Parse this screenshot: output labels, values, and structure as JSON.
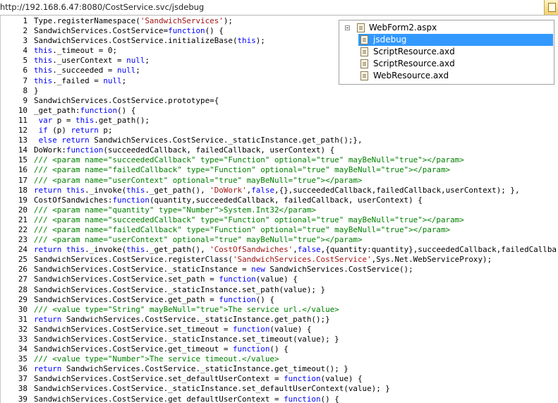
{
  "address_bar": {
    "url": "http://192.168.6.47:8080/CostService.svc/jsdebug"
  },
  "code_lines": [
    {
      "n": "1",
      "t": [
        [
          "p",
          "Type.registerNamespace("
        ],
        [
          "s",
          "'SandwichServices'"
        ],
        [
          "p",
          ");"
        ]
      ]
    },
    {
      "n": "2",
      "t": [
        [
          "p",
          "SandwichServices.CostService="
        ],
        [
          "k",
          "function"
        ],
        [
          "p",
          "() {"
        ]
      ]
    },
    {
      "n": "3",
      "t": [
        [
          "p",
          "SandwichServices.CostService.initializeBase("
        ],
        [
          "k",
          "this"
        ],
        [
          "p",
          ");"
        ]
      ]
    },
    {
      "n": "4",
      "t": [
        [
          "k",
          "this"
        ],
        [
          "p",
          "._timeout = 0;"
        ]
      ]
    },
    {
      "n": "5",
      "t": [
        [
          "k",
          "this"
        ],
        [
          "p",
          "._userContext = "
        ],
        [
          "k",
          "null"
        ],
        [
          "p",
          ";"
        ]
      ]
    },
    {
      "n": "6",
      "t": [
        [
          "k",
          "this"
        ],
        [
          "p",
          "._succeeded = "
        ],
        [
          "k",
          "null"
        ],
        [
          "p",
          ";"
        ]
      ]
    },
    {
      "n": "7",
      "t": [
        [
          "k",
          "this"
        ],
        [
          "p",
          "._failed = "
        ],
        [
          "k",
          "null"
        ],
        [
          "p",
          ";"
        ]
      ]
    },
    {
      "n": "8",
      "t": [
        [
          "p",
          "}"
        ]
      ]
    },
    {
      "n": "9",
      "t": [
        [
          "p",
          "SandwichServices.CostService.prototype={"
        ]
      ]
    },
    {
      "n": "10",
      "t": [
        [
          "p",
          "_get_path:"
        ],
        [
          "k",
          "function"
        ],
        [
          "p",
          "() {"
        ]
      ]
    },
    {
      "n": "11",
      "t": [
        [
          "p",
          " "
        ],
        [
          "k",
          "var"
        ],
        [
          "p",
          " p = "
        ],
        [
          "k",
          "this"
        ],
        [
          "p",
          ".get_path();"
        ]
      ]
    },
    {
      "n": "12",
      "t": [
        [
          "p",
          " "
        ],
        [
          "k",
          "if"
        ],
        [
          "p",
          " (p) "
        ],
        [
          "k",
          "return"
        ],
        [
          "p",
          " p;"
        ]
      ]
    },
    {
      "n": "13",
      "t": [
        [
          "p",
          " "
        ],
        [
          "k",
          "else"
        ],
        [
          "p",
          " "
        ],
        [
          "k",
          "return"
        ],
        [
          "p",
          " SandwichServices.CostService._staticInstance.get_path();},"
        ]
      ]
    },
    {
      "n": "14",
      "t": [
        [
          "p",
          "DoWork:"
        ],
        [
          "k",
          "function"
        ],
        [
          "p",
          "(succeededCallback, failedCallback, userContext) {"
        ]
      ]
    },
    {
      "n": "15",
      "t": [
        [
          "c",
          "/// <param name=\"succeededCallback\" type=\"Function\" optional=\"true\" mayBeNull=\"true\"></param>"
        ]
      ]
    },
    {
      "n": "16",
      "t": [
        [
          "c",
          "/// <param name=\"failedCallback\" type=\"Function\" optional=\"true\" mayBeNull=\"true\"></param>"
        ]
      ]
    },
    {
      "n": "17",
      "t": [
        [
          "c",
          "/// <param name=\"userContext\" optional=\"true\" mayBeNull=\"true\"></param>"
        ]
      ]
    },
    {
      "n": "18",
      "t": [
        [
          "k",
          "return"
        ],
        [
          "p",
          " "
        ],
        [
          "k",
          "this"
        ],
        [
          "p",
          "._invoke("
        ],
        [
          "k",
          "this"
        ],
        [
          "p",
          "._get_path(), "
        ],
        [
          "s",
          "'DoWork'"
        ],
        [
          "p",
          ","
        ],
        [
          "k",
          "false"
        ],
        [
          "p",
          ",{},succeededCallback,failedCallback,userContext); },"
        ]
      ]
    },
    {
      "n": "19",
      "t": [
        [
          "p",
          "CostOfSandwiches:"
        ],
        [
          "k",
          "function"
        ],
        [
          "p",
          "(quantity,succeededCallback, failedCallback, userContext) {"
        ]
      ]
    },
    {
      "n": "20",
      "t": [
        [
          "c",
          "/// <param name=\"quantity\" type=\"Number\">System.Int32</param>"
        ]
      ]
    },
    {
      "n": "21",
      "t": [
        [
          "c",
          "/// <param name=\"succeededCallback\" type=\"Function\" optional=\"true\" mayBeNull=\"true\"></param>"
        ]
      ]
    },
    {
      "n": "22",
      "t": [
        [
          "c",
          "/// <param name=\"failedCallback\" type=\"Function\" optional=\"true\" mayBeNull=\"true\"></param>"
        ]
      ]
    },
    {
      "n": "23",
      "t": [
        [
          "c",
          "/// <param name=\"userContext\" optional=\"true\" mayBeNull=\"true\"></param>"
        ]
      ]
    },
    {
      "n": "24",
      "t": [
        [
          "k",
          "return"
        ],
        [
          "p",
          " "
        ],
        [
          "k",
          "this"
        ],
        [
          "p",
          "._invoke("
        ],
        [
          "k",
          "this"
        ],
        [
          "p",
          "._get_path(), "
        ],
        [
          "s",
          "'CostOfSandwiches'"
        ],
        [
          "p",
          ","
        ],
        [
          "k",
          "false"
        ],
        [
          "p",
          ",{quantity:quantity},succeededCallback,failedCallba"
        ]
      ]
    },
    {
      "n": "25",
      "t": [
        [
          "p",
          "SandwichServices.CostService.registerClass("
        ],
        [
          "s",
          "'SandwichServices.CostService'"
        ],
        [
          "p",
          ",Sys.Net.WebServiceProxy);"
        ]
      ]
    },
    {
      "n": "26",
      "t": [
        [
          "p",
          "SandwichServices.CostService._staticInstance = "
        ],
        [
          "k",
          "new"
        ],
        [
          "p",
          " SandwichServices.CostService();"
        ]
      ]
    },
    {
      "n": "27",
      "t": [
        [
          "p",
          "SandwichServices.CostService.set_path = "
        ],
        [
          "k",
          "function"
        ],
        [
          "p",
          "(value) {"
        ]
      ]
    },
    {
      "n": "28",
      "t": [
        [
          "p",
          "SandwichServices.CostService._staticInstance.set_path(value); }"
        ]
      ]
    },
    {
      "n": "29",
      "t": [
        [
          "p",
          "SandwichServices.CostService.get_path = "
        ],
        [
          "k",
          "function"
        ],
        [
          "p",
          "() {"
        ]
      ]
    },
    {
      "n": "30",
      "t": [
        [
          "c",
          "/// <value type=\"String\" mayBeNull=\"true\">The service url.</value>"
        ]
      ]
    },
    {
      "n": "31",
      "t": [
        [
          "k",
          "return"
        ],
        [
          "p",
          " SandwichServices.CostService._staticInstance.get_path();}"
        ]
      ]
    },
    {
      "n": "32",
      "t": [
        [
          "p",
          "SandwichServices.CostService.set_timeout = "
        ],
        [
          "k",
          "function"
        ],
        [
          "p",
          "(value) {"
        ]
      ]
    },
    {
      "n": "33",
      "t": [
        [
          "p",
          "SandwichServices.CostService._staticInstance.set_timeout(value); }"
        ]
      ]
    },
    {
      "n": "34",
      "t": [
        [
          "p",
          "SandwichServices.CostService.get_timeout = "
        ],
        [
          "k",
          "function"
        ],
        [
          "p",
          "() {"
        ]
      ]
    },
    {
      "n": "35",
      "t": [
        [
          "c",
          "/// <value type=\"Number\">The service timeout.</value>"
        ]
      ]
    },
    {
      "n": "36",
      "t": [
        [
          "k",
          "return"
        ],
        [
          "p",
          " SandwichServices.CostService._staticInstance.get_timeout(); }"
        ]
      ]
    },
    {
      "n": "37",
      "t": [
        [
          "p",
          "SandwichServices.CostService.set_defaultUserContext = "
        ],
        [
          "k",
          "function"
        ],
        [
          "p",
          "(value) {"
        ]
      ]
    },
    {
      "n": "38",
      "t": [
        [
          "p",
          "SandwichServices.CostService._staticInstance.set_defaultUserContext(value); }"
        ]
      ]
    },
    {
      "n": "39",
      "t": [
        [
          "p",
          "SandwichServices.CostService.get_defaultUserContext = "
        ],
        [
          "k",
          "function"
        ],
        [
          "p",
          "() {"
        ]
      ]
    }
  ],
  "solution_tree": {
    "root": "WebForm2.aspx",
    "items": [
      "jsdebug",
      "ScriptResource.axd",
      "ScriptResource.axd",
      "WebResource.axd"
    ],
    "selected": "jsdebug"
  },
  "colors": {
    "keyword": "#0000ff",
    "string": "#a31515",
    "comment": "#008000",
    "selection": "#3399ff"
  }
}
